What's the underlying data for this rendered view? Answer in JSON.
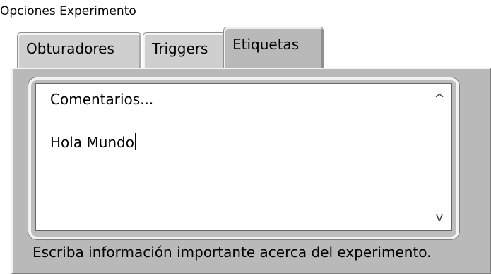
{
  "window": {
    "title": "Opciones Experimento"
  },
  "tabs": [
    {
      "label": "Obturadores",
      "active": false
    },
    {
      "label": "Triggers",
      "active": false
    },
    {
      "label": "Etiquetas",
      "active": true
    }
  ],
  "editor": {
    "lines": [
      "Comentarios...",
      "Hola Mundo"
    ],
    "scroll_up_icon": "^",
    "scroll_down_icon": "v"
  },
  "help_text": "Escriba información importante acerca del experimento.",
  "colors": {
    "panel_background": "#b9b9b9",
    "tab_background": "#cfcfcf",
    "text_background": "#ffffff"
  }
}
